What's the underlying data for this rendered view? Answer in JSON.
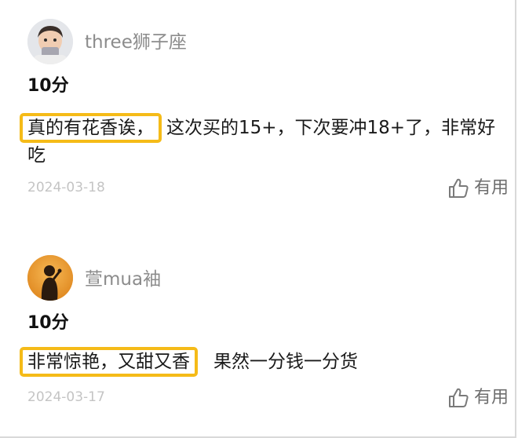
{
  "reviews": [
    {
      "username": "three狮子座",
      "score": "10分",
      "highlight": "真的有花香诶，",
      "text": "这次买的15+，下次要冲18+了，非常好吃",
      "date": "2024-03-18",
      "useful_label": "有用"
    },
    {
      "username": "萱mua袖",
      "score": "10分",
      "highlight": "非常惊艳，又甜又香",
      "text": "果然一分钱一分货",
      "date": "2024-03-17",
      "useful_label": "有用"
    }
  ],
  "colors": {
    "highlight_border": "#f5bb18",
    "username": "#8c8c8c",
    "date": "#c4c4c4"
  },
  "icons": [
    "thumbs-up-icon"
  ]
}
